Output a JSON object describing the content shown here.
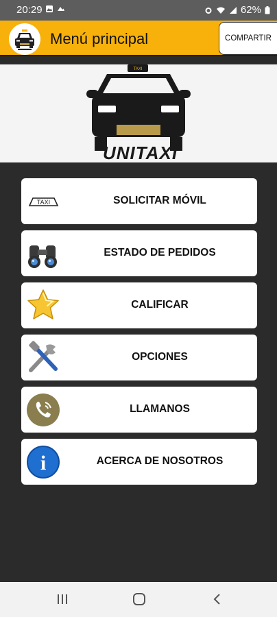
{
  "status_bar": {
    "time": "20:29",
    "battery": "62%",
    "left_icons": [
      "gallery-icon",
      "cloud-icon"
    ],
    "right_icons": [
      "alarm-icon",
      "wifi-icon",
      "signal-icon",
      "battery-icon"
    ]
  },
  "app_bar": {
    "title": "Menú principal",
    "share_label": "COMPARTIR",
    "brand_color": "#f7b10a"
  },
  "banner": {
    "brand": "UNITAXI",
    "taxi_sign": "TAXI"
  },
  "menu": [
    {
      "label": "SOLICITAR MÓVIL",
      "icon": "taxi-sign-icon",
      "icon_text": "TAXI"
    },
    {
      "label": "ESTADO DE PEDIDOS",
      "icon": "binoculars-icon"
    },
    {
      "label": "CALIFICAR",
      "icon": "star-icon"
    },
    {
      "label": "OPCIONES",
      "icon": "tools-icon"
    },
    {
      "label": "LLAMANOS",
      "icon": "phone-icon"
    },
    {
      "label": "ACERCA DE NOSOTROS",
      "icon": "info-icon",
      "icon_text": "i"
    }
  ],
  "nav": {
    "buttons": [
      "recents-icon",
      "home-icon",
      "back-icon"
    ]
  }
}
